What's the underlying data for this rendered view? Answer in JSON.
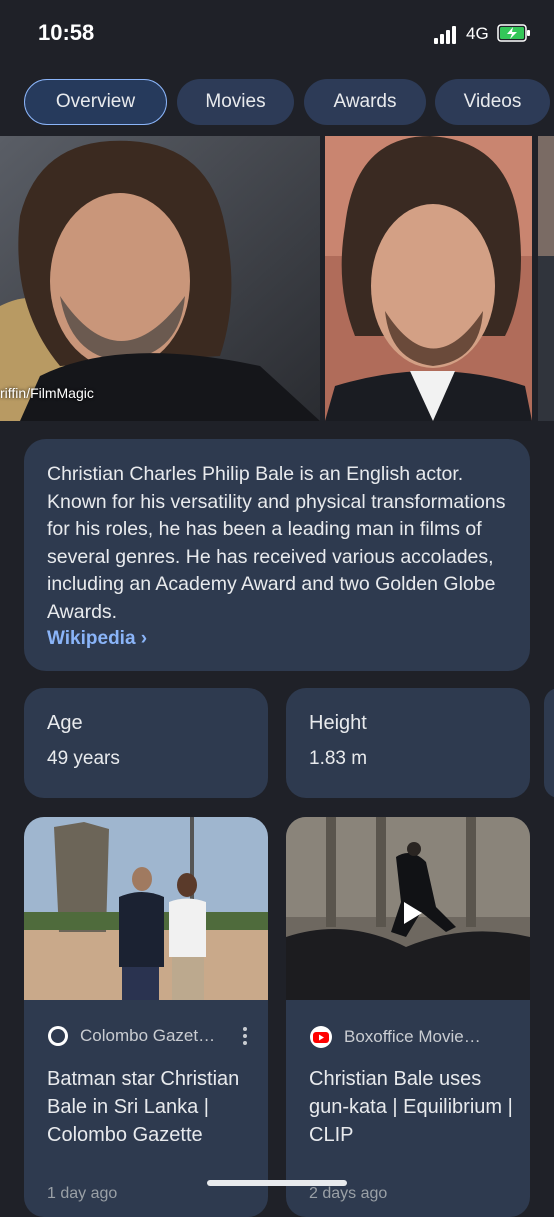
{
  "status_bar": {
    "time": "10:58",
    "network": "4G"
  },
  "tabs": [
    {
      "label": "Overview",
      "active": true
    },
    {
      "label": "Movies",
      "active": false
    },
    {
      "label": "Awards",
      "active": false
    },
    {
      "label": "Videos",
      "active": false
    }
  ],
  "images": {
    "credit": "riffin/FilmMagic"
  },
  "description": {
    "text": "Christian Charles Philip Bale is an English actor. Known for his versatility and physical transformations for his roles, he has been a leading man in films of several genres. He has received various accolades, including an Academy Award and two Golden Globe Awards.",
    "source_link": "Wikipedia ›"
  },
  "facts": [
    {
      "label": "Age",
      "value": "49 years"
    },
    {
      "label": "Height",
      "value": "1.83 m"
    }
  ],
  "news": [
    {
      "source": "Colombo Gazet…",
      "title": "Batman star Christian Bale in Sri Lanka | Colombo Gazette",
      "time": "1 day ago"
    },
    {
      "source": "Boxoffice Movie…",
      "title": "Christian Bale uses gun-kata | Equilibrium | CLIP",
      "time": "2 days ago"
    }
  ],
  "colors": {
    "accent": "#8ab4f8",
    "card": "#2e3a4f",
    "background": "#1f2128"
  }
}
